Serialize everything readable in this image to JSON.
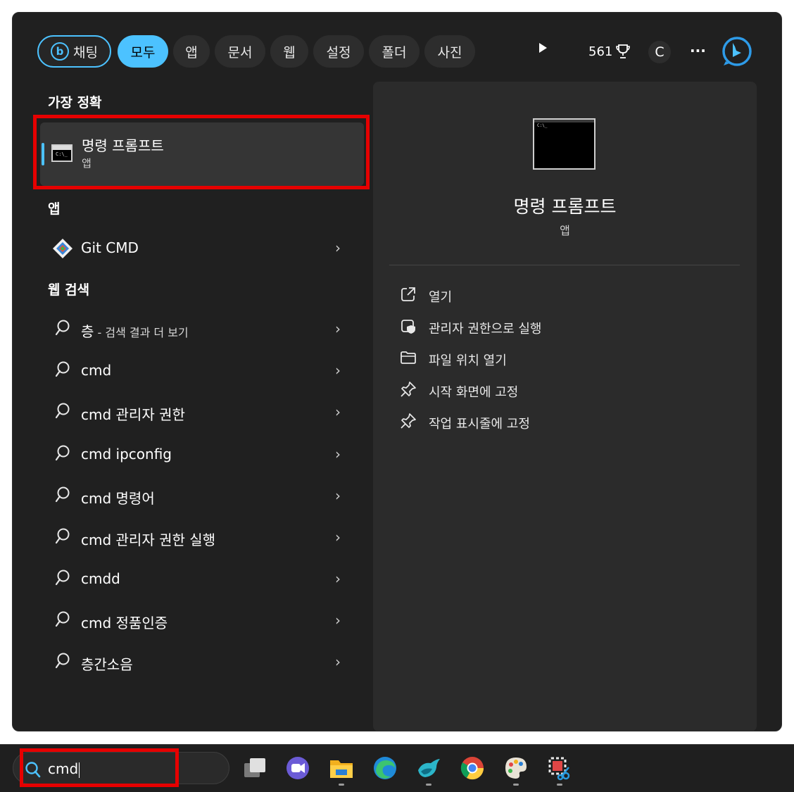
{
  "tabs": {
    "chat": "채팅",
    "all": "모두",
    "apps": "앱",
    "documents": "문서",
    "web": "웹",
    "settings": "설정",
    "folders": "폴더",
    "photos": "사진"
  },
  "header": {
    "points": "561",
    "account_initial": "C",
    "more": "···"
  },
  "best_match": {
    "section_title": "가장 정확",
    "name": "명령 프롬프트",
    "type": "앱"
  },
  "apps_section": {
    "title": "앱",
    "items": [
      {
        "label": "Git CMD"
      }
    ]
  },
  "web_section": {
    "title": "웹 검색",
    "items": [
      {
        "label": "층",
        "suffix": " - 검색 결과 더 보기"
      },
      {
        "label": "cmd"
      },
      {
        "label": "cmd 관리자 권한"
      },
      {
        "label": "cmd ipconfig"
      },
      {
        "label": "cmd 명령어"
      },
      {
        "label": "cmd 관리자 권한 실행"
      },
      {
        "label": "cmdd"
      },
      {
        "label": "cmd 정품인증"
      },
      {
        "label": "층간소음"
      }
    ]
  },
  "detail": {
    "title": "명령 프롬프트",
    "subtitle": "앱",
    "actions": [
      {
        "label": "열기",
        "icon": "open-external-icon"
      },
      {
        "label": "관리자 권한으로 실행",
        "icon": "shield-run-as-admin-icon"
      },
      {
        "label": "파일 위치 열기",
        "icon": "folder-icon"
      },
      {
        "label": "시작 화면에 고정",
        "icon": "pin-icon"
      },
      {
        "label": "작업 표시줄에 고정",
        "icon": "pin-icon"
      }
    ]
  },
  "taskbar": {
    "search_value": "cmd",
    "apps": [
      "task-view-icon",
      "teams-chat-icon",
      "file-explorer-icon",
      "edge-icon",
      "bird-app-icon",
      "chrome-icon",
      "paint-icon",
      "snipping-tool-icon"
    ]
  },
  "colors": {
    "accent": "#4cc2ff",
    "panel": "#202020",
    "detail_panel": "#2b2b2b",
    "highlight": "#e60000"
  }
}
